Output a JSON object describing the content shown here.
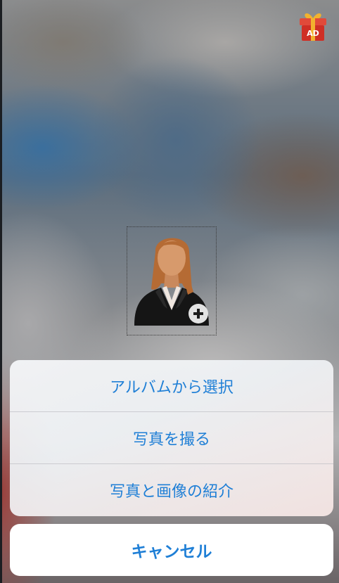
{
  "ad_badge": {
    "label": "AD",
    "icon": "gift-icon"
  },
  "avatar": {
    "icon": "woman-avatar-icon",
    "add_icon": "plus-circle-icon"
  },
  "action_sheet": {
    "items": [
      {
        "label": "アルバムから選択"
      },
      {
        "label": "写真を撮る"
      },
      {
        "label": "写真と画像の紹介"
      }
    ],
    "cancel_label": "キャンセル"
  },
  "colors": {
    "accent": "#1f7fd6",
    "gift_red": "#d8372b",
    "gift_ribbon": "#f2b22e"
  }
}
